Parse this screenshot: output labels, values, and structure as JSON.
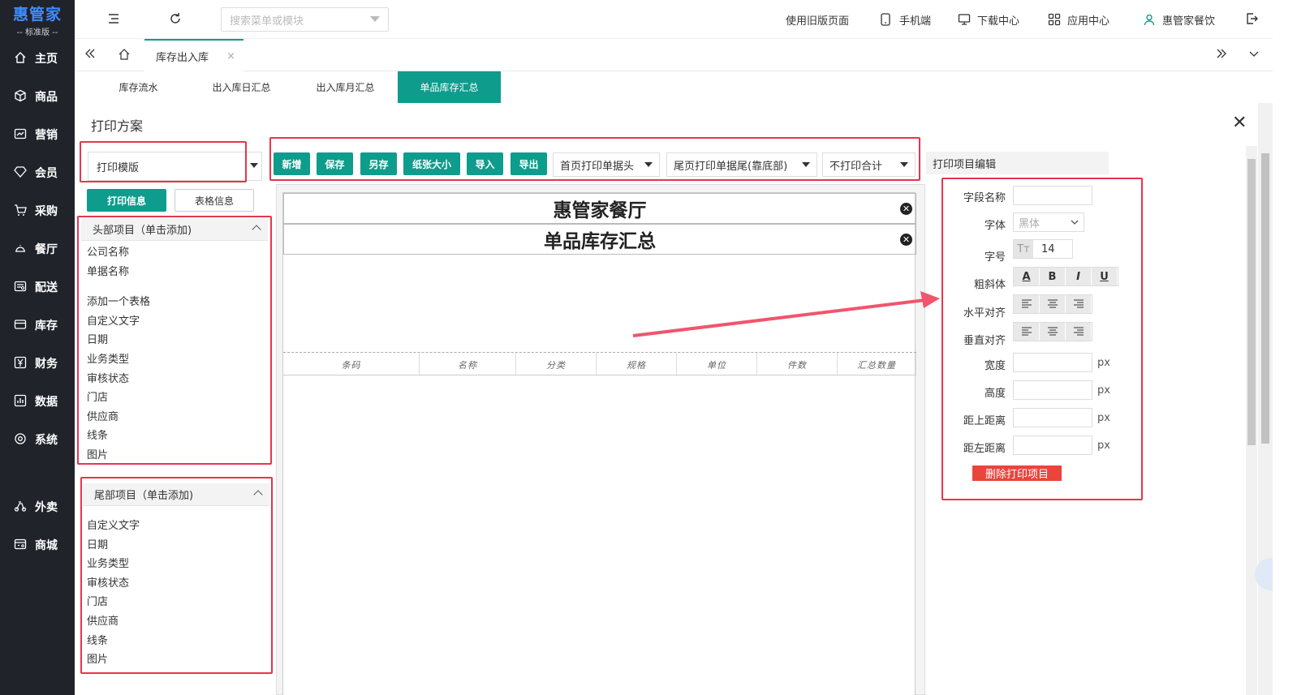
{
  "app": {
    "logo_main": "惠管家",
    "logo_sub": "-- 标准版 --"
  },
  "sidebar": {
    "items": [
      {
        "label": "主页",
        "icon": "home-icon"
      },
      {
        "label": "商品",
        "icon": "cube-icon"
      },
      {
        "label": "营销",
        "icon": "chart-icon"
      },
      {
        "label": "会员",
        "icon": "diamond-icon"
      },
      {
        "label": "采购",
        "icon": "cart-icon"
      },
      {
        "label": "餐厅",
        "icon": "cloche-icon"
      },
      {
        "label": "配送",
        "icon": "truck-icon"
      },
      {
        "label": "库存",
        "icon": "box-icon"
      },
      {
        "label": "财务",
        "icon": "yen-icon"
      },
      {
        "label": "数据",
        "icon": "bar-chart-icon"
      },
      {
        "label": "系统",
        "icon": "gear-icon"
      }
    ],
    "items_bottom": [
      {
        "label": "外卖",
        "icon": "scooter-icon"
      },
      {
        "label": "商城",
        "icon": "shop-icon"
      }
    ]
  },
  "topbar": {
    "search_placeholder": "搜索菜单或模块",
    "links": {
      "old_page": "使用旧版页面",
      "mobile": "手机端",
      "download": "下载中心",
      "app_center": "应用中心",
      "user": "惠管家餐饮"
    }
  },
  "tabs": {
    "active": "库存出入库",
    "close_glyph": "×"
  },
  "subtabs": [
    "库存流水",
    "出入库日汇总",
    "出入库月汇总",
    "单品库存汇总"
  ],
  "print_plan": {
    "title": "打印方案",
    "template_select": "打印模版",
    "btn_print_info": "打印信息",
    "btn_table_info": "表格信息",
    "toolbar": {
      "add": "新增",
      "save": "保存",
      "save_as": "另存",
      "paper_size": "纸张大小",
      "import": "导入",
      "export": "导出",
      "first_page_header": "首页打印单据头",
      "last_page_footer": "尾页打印单据尾(靠底部)",
      "no_total": "不打印合计"
    },
    "header_panel": {
      "title": "头部项目（单击添加)",
      "items": [
        "公司名称",
        "单据名称",
        "",
        "添加一个表格",
        "自定义文字",
        "日期",
        "业务类型",
        "审核状态",
        "门店",
        "供应商",
        "线条",
        "图片"
      ]
    },
    "footer_panel": {
      "title": "尾部项目（单击添加)",
      "items": [
        "自定义文字",
        "日期",
        "业务类型",
        "审核状态",
        "门店",
        "供应商",
        "线条",
        "图片"
      ]
    },
    "paper": {
      "company": "惠管家餐厅",
      "doc_name": "单品库存汇总",
      "del_glyph": "✕",
      "columns": [
        "条码",
        "名称",
        "分类",
        "规格",
        "单位",
        "件数",
        "汇总数量"
      ]
    },
    "editor": {
      "title": "打印项目编辑",
      "field_name": "字段名称",
      "font": "字体",
      "font_value": "黑体",
      "font_size": "字号",
      "font_size_value": "14",
      "style": "粗斜体",
      "style_buttons": [
        "A",
        "B",
        "I",
        "U"
      ],
      "h_align": "水平对齐",
      "v_align": "垂直对齐",
      "width": "宽度",
      "height": "高度",
      "top": "距上距离",
      "left": "距左距离",
      "unit": "px",
      "delete": "删除打印项目"
    }
  }
}
